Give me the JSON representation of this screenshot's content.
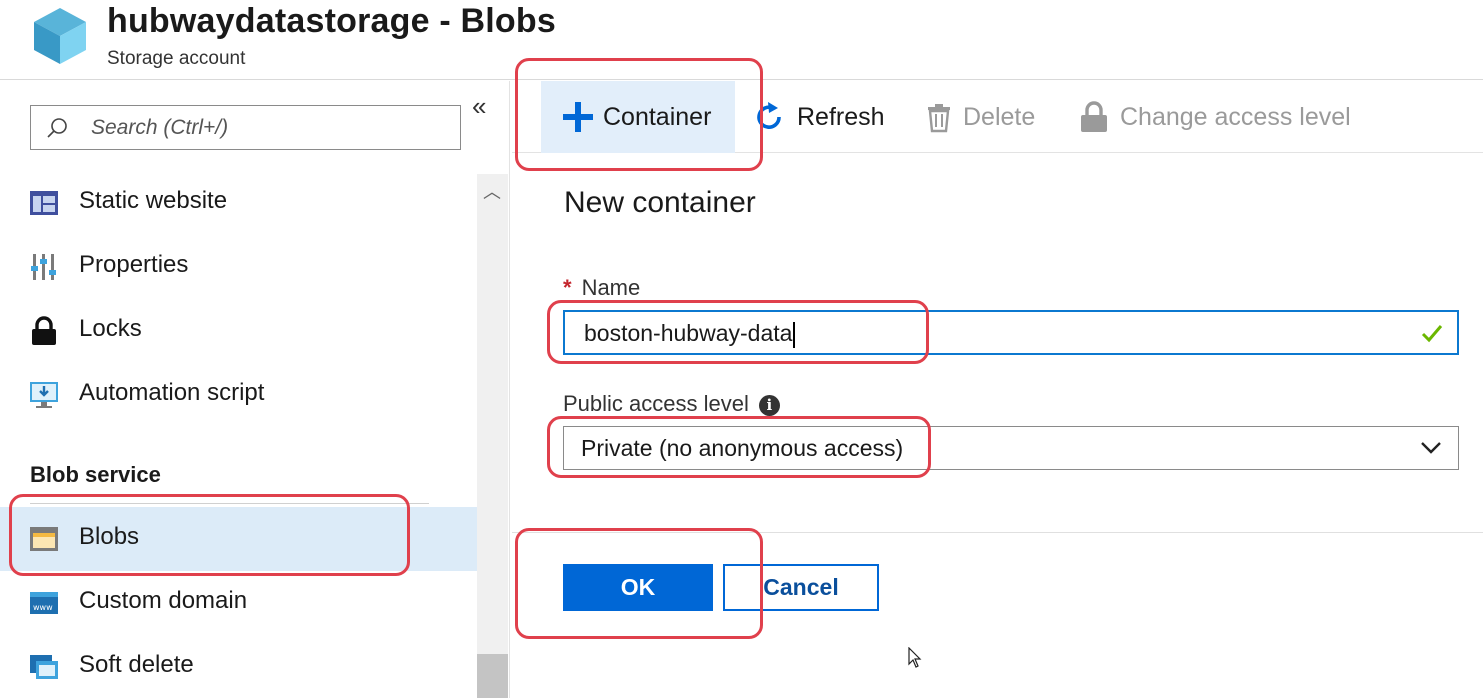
{
  "header": {
    "title": "hubwaydatastorage - Blobs",
    "subtitle": "Storage account"
  },
  "sidebar": {
    "collapse_glyph": "«",
    "search": {
      "placeholder": "Search (Ctrl+/)"
    },
    "items": [
      {
        "label": "Static website",
        "icon": "static-website-icon"
      },
      {
        "label": "Properties",
        "icon": "properties-icon"
      },
      {
        "label": "Locks",
        "icon": "lock-icon"
      },
      {
        "label": "Automation script",
        "icon": "automation-script-icon"
      }
    ],
    "section_heading": "Blob service",
    "section_items": [
      {
        "label": "Blobs",
        "icon": "blobs-icon",
        "active": true
      },
      {
        "label": "Custom domain",
        "icon": "custom-domain-icon"
      },
      {
        "label": "Soft delete",
        "icon": "soft-delete-icon"
      }
    ]
  },
  "toolbar": {
    "container_label": "Container",
    "refresh_label": "Refresh",
    "delete_label": "Delete",
    "change_access_label": "Change access level"
  },
  "panel": {
    "title": "New container",
    "name_label": "Name",
    "required_marker": "*",
    "name_value": "boston-hubway-data",
    "access_label": "Public access level",
    "info_glyph": "i",
    "access_value": "Private (no anonymous access)",
    "ok_label": "OK",
    "cancel_label": "Cancel"
  },
  "colors": {
    "accent": "#0067d6",
    "active_bg": "#dcebf8",
    "highlight": "#e0404c",
    "valid_check": "#6bb700"
  }
}
